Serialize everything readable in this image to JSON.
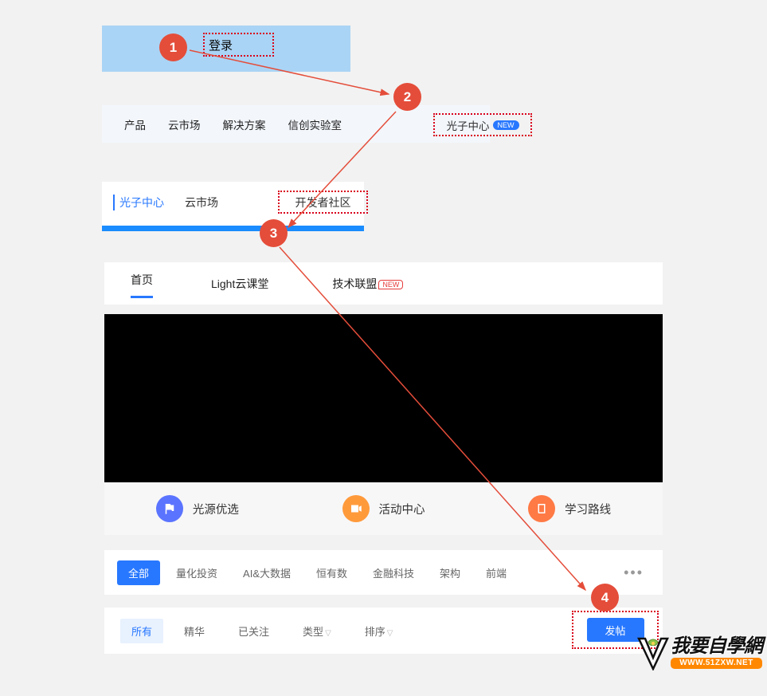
{
  "steps": {
    "s1": "1",
    "s2": "2",
    "s3": "3",
    "s4": "4"
  },
  "login": {
    "label": "登录"
  },
  "nav1": {
    "items": [
      "产品",
      "云市场",
      "解决方案",
      "信创实验室"
    ],
    "photon": "光子中心",
    "new_badge": "NEW"
  },
  "nav2": {
    "photon": "光子中心",
    "market": "云市场",
    "dev": "开发者社区"
  },
  "tabs": {
    "home": "首页",
    "cloud": "Light云课堂",
    "alliance": "技术联盟",
    "new_badge": "NEW"
  },
  "icon_row": {
    "i1": {
      "label": "光源优选",
      "color": "#5b74ff"
    },
    "i2": {
      "label": "活动中心",
      "color": "#ff9a3b"
    },
    "i3": {
      "label": "学习路线",
      "color": "#ff7a45"
    }
  },
  "categories": {
    "all": "全部",
    "items": [
      "量化投资",
      "AI&大数据",
      "恒有数",
      "金融科技",
      "架构",
      "前端"
    ],
    "more": "•••"
  },
  "filters": {
    "all": "所有",
    "items": [
      "精华",
      "已关注"
    ],
    "type": "类型",
    "sort": "排序",
    "publish": "发帖"
  },
  "watermark": {
    "cn": "我要自學網",
    "url": "WWW.51ZXW.NET"
  }
}
